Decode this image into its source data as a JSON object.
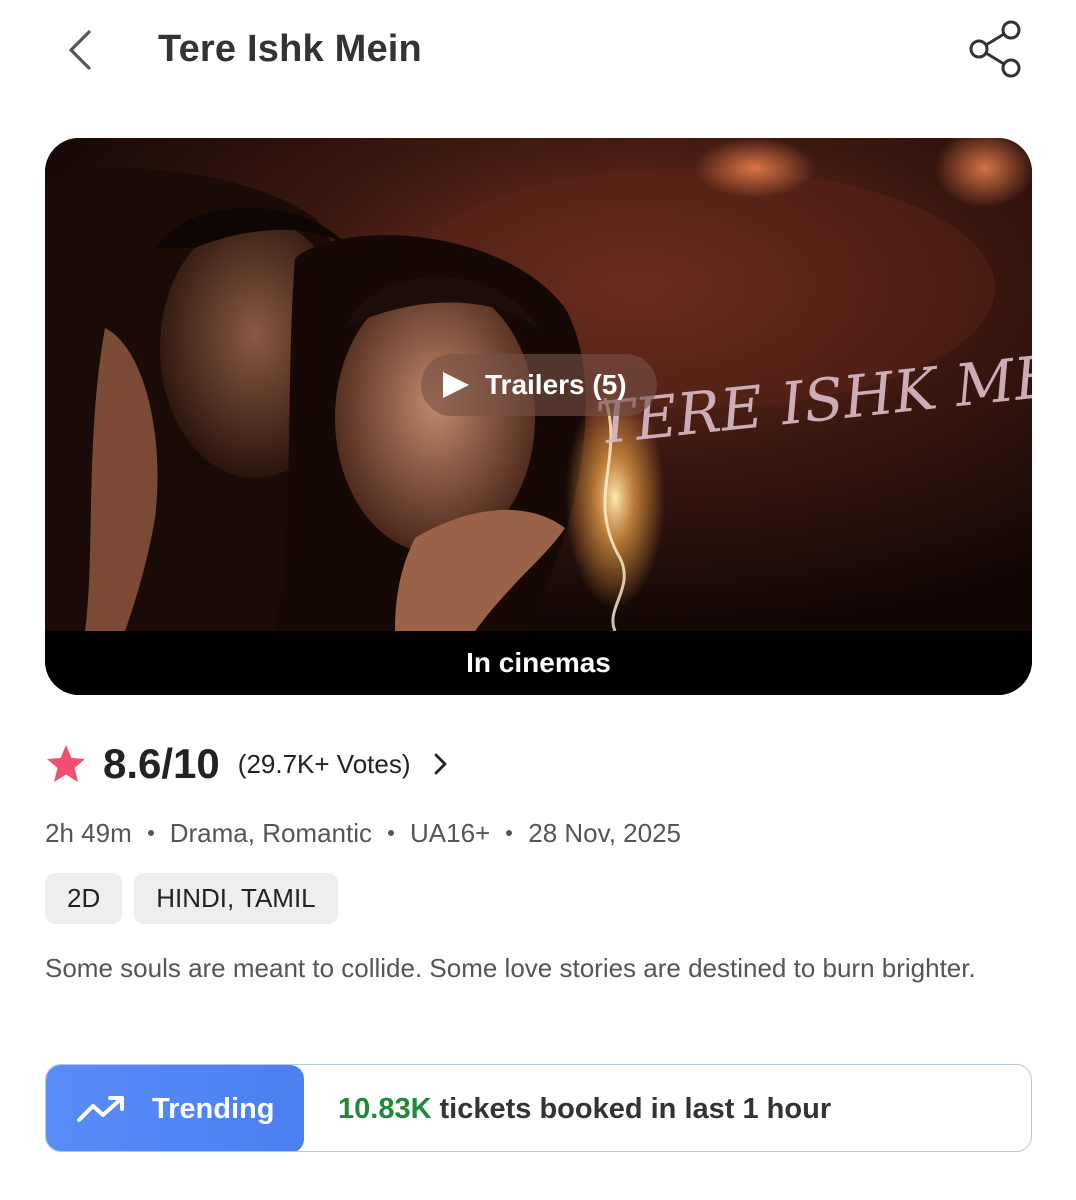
{
  "header": {
    "title": "Tere Ishk Mein",
    "back_icon": "chevron-left-icon",
    "share_icon": "share-icon"
  },
  "poster": {
    "artwork_title": "TERE ISHK MEIN",
    "trailer_label": "Trailers (5)",
    "status": "In cinemas"
  },
  "rating": {
    "value": "8.6/10",
    "votes": "(29.7K+ Votes)",
    "star_color": "#f0506e"
  },
  "meta": {
    "duration": "2h 49m",
    "genres": "Drama, Romantic",
    "certificate": "UA16+",
    "release_date": "28 Nov, 2025"
  },
  "tags": [
    "2D",
    "HINDI, TAMIL"
  ],
  "synopsis": "Some souls are meant to collide. Some love stories are destined to burn brighter.",
  "trending": {
    "label": "Trending",
    "count": "10.83K",
    "text": "tickets booked in last 1 hour",
    "accent": "#4b7ff2",
    "count_color": "#1f8a3a"
  }
}
